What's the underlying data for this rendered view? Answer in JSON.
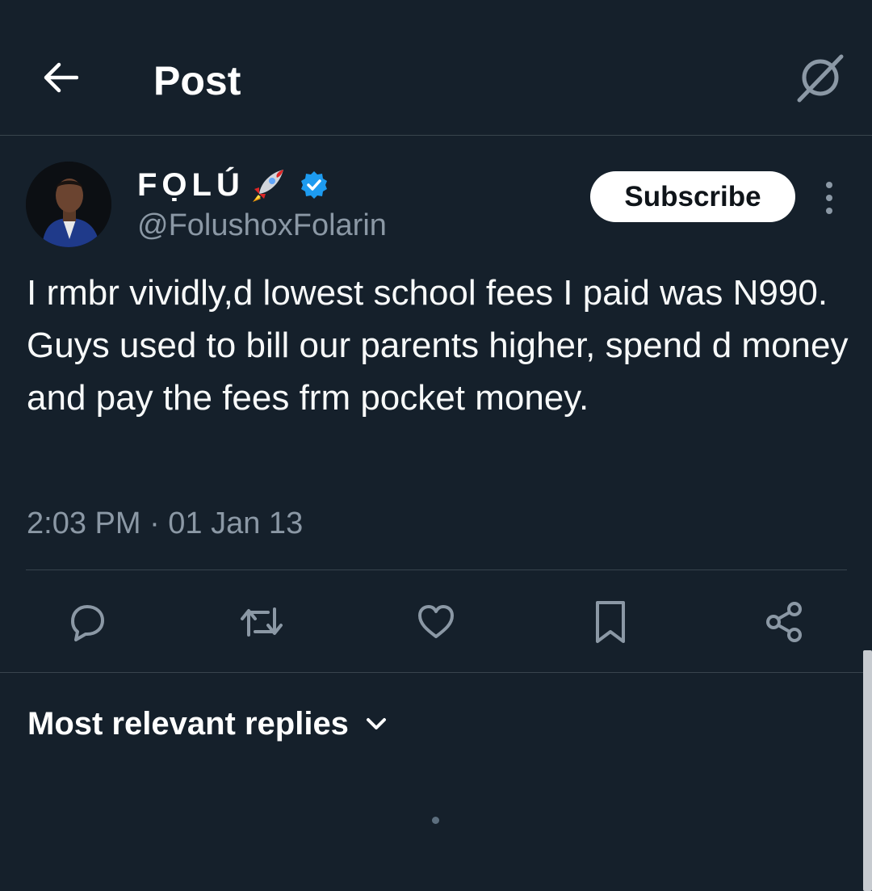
{
  "header": {
    "title": "Post",
    "back_icon": "arrow-left-icon",
    "grok_icon": "grok-icon"
  },
  "author": {
    "display_name": "FỌLÚ",
    "name_emoji": "rocket-icon",
    "verified_icon": "verified-badge-icon",
    "handle": "@FolushoxFolarin",
    "subscribe_label": "Subscribe",
    "more_icon": "more-vertical-icon"
  },
  "post": {
    "text": "I rmbr vividly,d lowest school fees I paid was N990. Guys used to bill our parents higher, spend d money and pay the fees frm pocket money.",
    "timestamp": "2:03 PM · 01 Jan 13"
  },
  "actions": [
    {
      "icon": "reply-icon"
    },
    {
      "icon": "repost-icon"
    },
    {
      "icon": "like-icon"
    },
    {
      "icon": "bookmark-icon"
    },
    {
      "icon": "share-icon"
    }
  ],
  "replies": {
    "sort_label": "Most relevant replies",
    "sort_icon": "chevron-down-icon"
  },
  "colors": {
    "background": "#15202b",
    "text": "#ffffff",
    "secondary_text": "#8b98a5",
    "divider": "#38444d",
    "verified": "#1d9bf0"
  }
}
